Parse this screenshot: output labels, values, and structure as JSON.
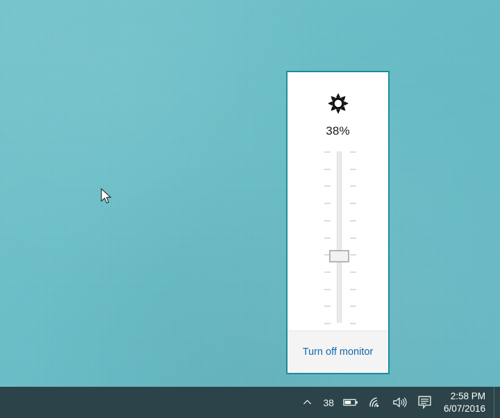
{
  "desktop": {
    "background_color": "#6bbfc8",
    "cursor_name": "arrow-cursor"
  },
  "brightness_panel": {
    "icon_name": "brightness-sun-icon",
    "value_label": "38%",
    "brightness_percent": 38,
    "slider": {
      "name": "brightness-slider",
      "orientation": "vertical",
      "min": 0,
      "max": 100,
      "value": 38,
      "tick_count_per_side": 11,
      "track_color": "#eaeaea",
      "thumb_border_color": "#b5b5b5"
    },
    "turn_off_label": "Turn off monitor",
    "accent_color": "#1b8c9b",
    "link_color": "#1266a8"
  },
  "taskbar": {
    "background_color": "#2c4449",
    "tray": {
      "overflow_icon": "chevron-up-icon",
      "battery_percent_label": "38",
      "battery_icon": "battery-icon",
      "wifi_icon": "wifi-icon",
      "volume_icon": "speaker-icon",
      "action_center_icon": "notification-icon"
    },
    "clock": {
      "time": "2:58 PM",
      "date": "6/07/2016"
    },
    "show_desktop_name": "show-desktop-button"
  }
}
